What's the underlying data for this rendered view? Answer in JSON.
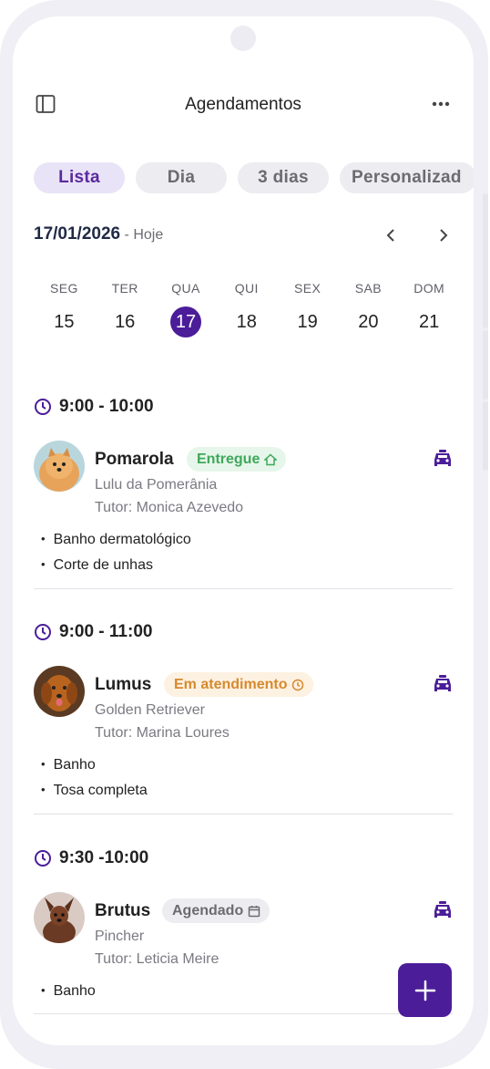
{
  "header": {
    "title": "Agendamentos"
  },
  "tabs": [
    {
      "label": "Lista",
      "active": true
    },
    {
      "label": "Dia",
      "active": false
    },
    {
      "label": "3 dias",
      "active": false
    },
    {
      "label": "Personalizad",
      "active": false
    }
  ],
  "date": {
    "value": "17/01/2026",
    "sub": "- Hoje"
  },
  "week": [
    {
      "wd": "SEG",
      "num": "15"
    },
    {
      "wd": "TER",
      "num": "16"
    },
    {
      "wd": "QUA",
      "num": "17",
      "selected": true
    },
    {
      "wd": "QUI",
      "num": "18"
    },
    {
      "wd": "SEX",
      "num": "19"
    },
    {
      "wd": "SAB",
      "num": "20"
    },
    {
      "wd": "DOM",
      "num": "21"
    }
  ],
  "appointments": [
    {
      "time": "9:00 - 10:00",
      "pet": "Pomarola",
      "status": "Entregue",
      "status_color": "#3fa85a",
      "status_bg": "#e6f6ea",
      "status_icon": "home-icon",
      "breed": "Lulu da Pomerânia",
      "tutor": "Tutor: Monica Azevedo",
      "services": [
        "Banho dermatológico",
        "Corte de unhas"
      ]
    },
    {
      "time": "9:00 - 11:00",
      "pet": "Lumus",
      "status": "Em atendimento",
      "status_color": "#d68a2e",
      "status_bg": "#fdf1e2",
      "status_icon": "clock-icon",
      "breed": "Golden Retriever",
      "tutor": "Tutor: Marina Loures",
      "services": [
        "Banho",
        "Tosa completa"
      ]
    },
    {
      "time": "9:30 -10:00",
      "pet": "Brutus",
      "status": "Agendado",
      "status_color": "#6b6b72",
      "status_bg": "#ececf1",
      "status_icon": "calendar-icon",
      "breed": "Pincher",
      "tutor": "Tutor: Leticia Meire",
      "services": [
        "Banho"
      ]
    }
  ],
  "colors": {
    "accent": "#4b1d99",
    "accent_light": "#e9e3f7"
  },
  "icons": [
    "sidebar-toggle-icon",
    "more-icon",
    "chevron-left-icon",
    "chevron-right-icon",
    "clock-icon",
    "car-icon",
    "plus-icon"
  ]
}
